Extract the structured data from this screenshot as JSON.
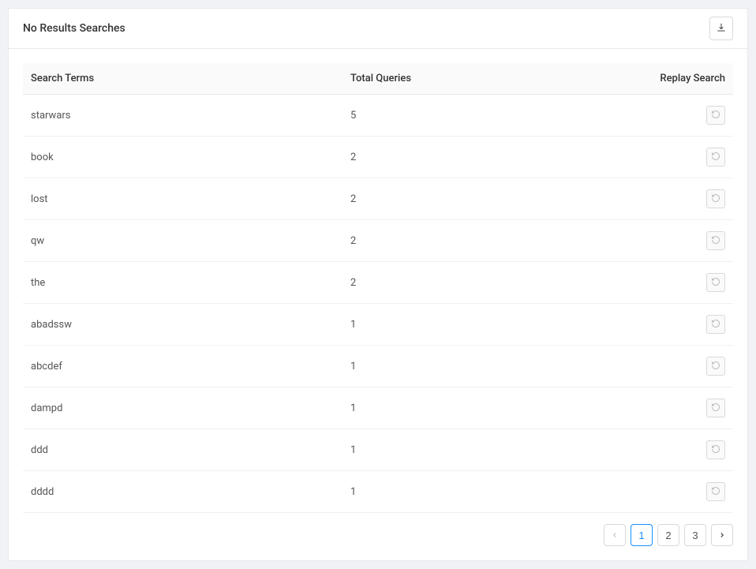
{
  "header": {
    "title": "No Results Searches"
  },
  "table": {
    "columns": {
      "terms": "Search Terms",
      "queries": "Total Queries",
      "replay": "Replay Search"
    },
    "rows": [
      {
        "term": "starwars",
        "queries": "5"
      },
      {
        "term": "book",
        "queries": "2"
      },
      {
        "term": "lost",
        "queries": "2"
      },
      {
        "term": "qw",
        "queries": "2"
      },
      {
        "term": "the",
        "queries": "2"
      },
      {
        "term": "abadssw",
        "queries": "1"
      },
      {
        "term": "abcdef",
        "queries": "1"
      },
      {
        "term": "dampd",
        "queries": "1"
      },
      {
        "term": "ddd",
        "queries": "1"
      },
      {
        "term": "dddd",
        "queries": "1"
      }
    ]
  },
  "pagination": {
    "pages": [
      "1",
      "2",
      "3"
    ],
    "current": "1"
  }
}
